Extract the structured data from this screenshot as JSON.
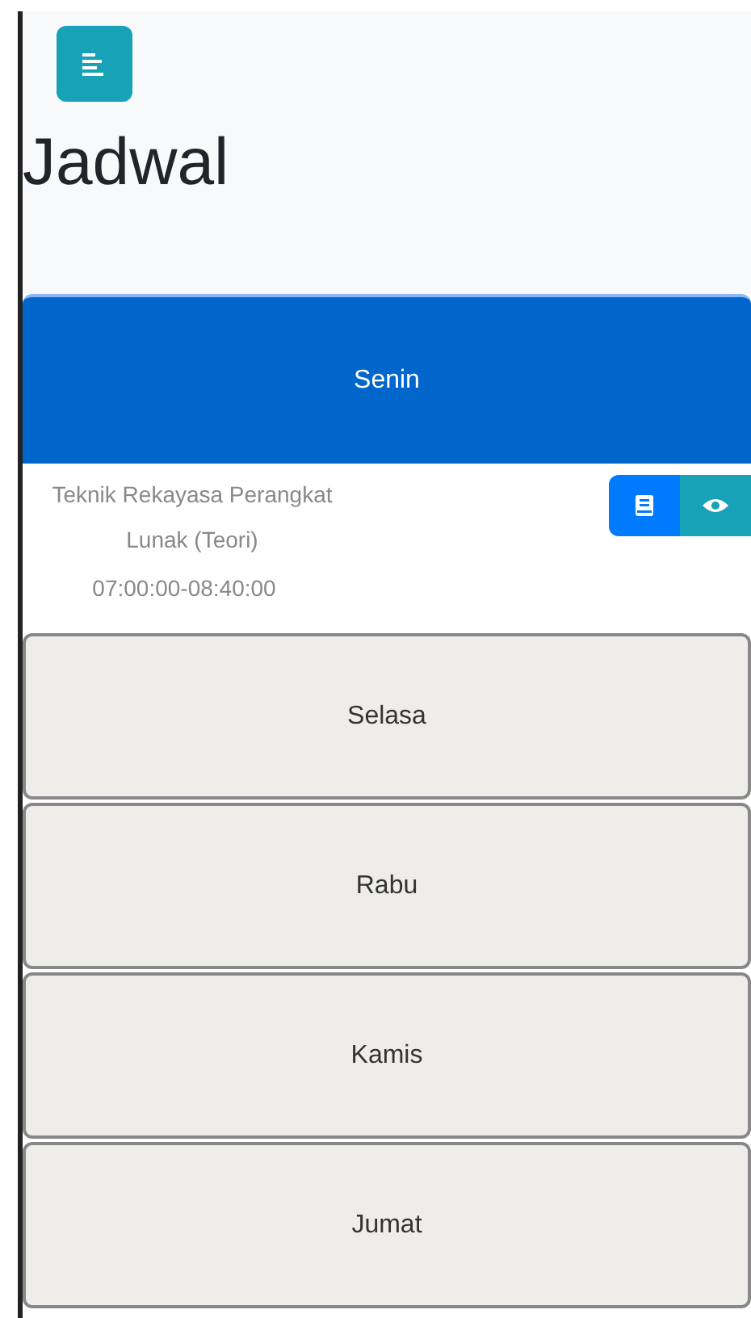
{
  "title": "Jadwal",
  "days": [
    {
      "label": "Senin",
      "selected": true,
      "entries": [
        {
          "course": "Teknik Rekayasa Perangkat Lunak (Teori)",
          "time": "07:00:00-08:40:00"
        }
      ]
    },
    {
      "label": "Selasa",
      "selected": false
    },
    {
      "label": "Rabu",
      "selected": false
    },
    {
      "label": "Kamis",
      "selected": false
    },
    {
      "label": "Jumat",
      "selected": false
    }
  ]
}
